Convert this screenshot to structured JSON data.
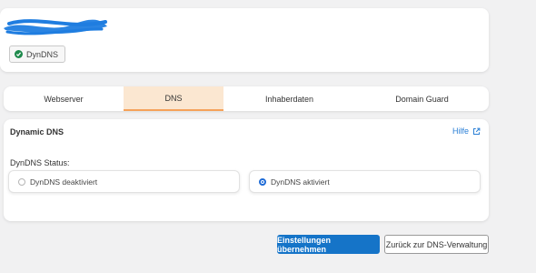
{
  "header": {
    "badge_label": "DynDNS",
    "badge_icon": "check-circle-icon"
  },
  "tabs": [
    {
      "label": "Webserver",
      "active": false
    },
    {
      "label": "DNS",
      "active": true
    },
    {
      "label": "Inhaberdaten",
      "active": false
    },
    {
      "label": "Domain Guard",
      "active": false
    }
  ],
  "dynamic_dns": {
    "title": "Dynamic DNS",
    "help_label": "Hilfe",
    "help_icon": "external-link-icon",
    "status_label": "DynDNS Status:",
    "options": [
      {
        "label": "DynDNS deaktiviert",
        "selected": false
      },
      {
        "label": "DynDNS aktiviert",
        "selected": true
      }
    ]
  },
  "actions": {
    "apply_label": "Einstellungen übernehmen",
    "back_label": "Zurück zur DNS-Verwaltung"
  },
  "colors": {
    "accent": "#1574c8",
    "active_tab_bg": "#fbe7d1",
    "active_tab_border": "#f5a25a",
    "success": "#1e8a4c",
    "link": "#2a7fd6",
    "redaction": "#1f7de0"
  }
}
